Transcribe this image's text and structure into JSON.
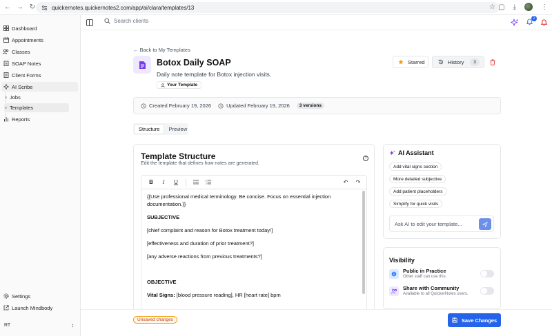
{
  "browser": {
    "url": "quickernotes.quickernotes2.com/app/ai/clara/templates/13"
  },
  "sidebar": {
    "items": [
      {
        "label": "Dashboard",
        "icon": "grid-icon"
      },
      {
        "label": "Appointments",
        "icon": "calendar-icon"
      },
      {
        "label": "Classes",
        "icon": "users-icon"
      },
      {
        "label": "SOAP Notes",
        "icon": "clipboard-icon"
      },
      {
        "label": "Client Forms",
        "icon": "form-icon"
      },
      {
        "label": "AI Scribe",
        "icon": "sparkle-icon"
      }
    ],
    "sub_items": [
      {
        "label": "Jobs"
      },
      {
        "label": "Templates"
      }
    ],
    "reports_label": "Reports",
    "settings_label": "Settings",
    "launch_label": "Launch Mindbody",
    "user_initials": "RT"
  },
  "topbar": {
    "search_placeholder": "Search clients",
    "notification_count": "2"
  },
  "page": {
    "back_label": "Back to My Templates",
    "title": "Botox Daily SOAP",
    "description": "Daily note template for Botox injection visits.",
    "owner_badge": "Your Template",
    "starred_label": "Starred",
    "history_label": "History",
    "history_count": "3",
    "created": "Created February 19, 2026",
    "updated": "Updated February 19, 2026",
    "versions": "3 versions",
    "tabs": [
      {
        "label": "Structure"
      },
      {
        "label": "Preview"
      }
    ]
  },
  "editor": {
    "title": "Template Structure",
    "subtitle": "Edit the template that defines how notes are generated.",
    "lines": [
      {
        "text": "{{Use professional medical terminology. Be concise. Focus on essential injection",
        "bold": false
      },
      {
        "text": "documentation.}}",
        "bold": false
      },
      {
        "text": "SUBJECTIVE",
        "bold": true
      },
      {
        "text": "[chief complaint and reason for Botox treatment today!]",
        "bold": false
      },
      {
        "text": "[effectiveness and duration of prior treatment?]",
        "bold": false
      },
      {
        "text": "[any adverse reactions from previous treatments?]",
        "bold": false
      },
      {
        "text": "OBJECTIVE",
        "bold": true
      }
    ],
    "vital_label": "Vital Signs:",
    "vital_value": " [blood pressure reading], HR [heart rate] bpm"
  },
  "ai_assistant": {
    "title": "AI Assistant",
    "chips": [
      "Add vital signs section",
      "More detailed subjective",
      "Add patient placeholders",
      "Simplify for quick visits"
    ],
    "input_placeholder": "Ask AI to edit your template..."
  },
  "visibility": {
    "title": "Visibility",
    "options": [
      {
        "title": "Public in Practice",
        "desc": "Other staff can use this.",
        "enabled": false
      },
      {
        "title": "Share with Community",
        "desc": "Available to all QuickerNotes users.",
        "enabled": false
      }
    ]
  },
  "footer": {
    "unsaved": "Unsaved changes",
    "save": "Save Changes"
  },
  "colors": {
    "accent": "#2563eb",
    "delete": "#dc2626",
    "star": "#f59e0b"
  }
}
